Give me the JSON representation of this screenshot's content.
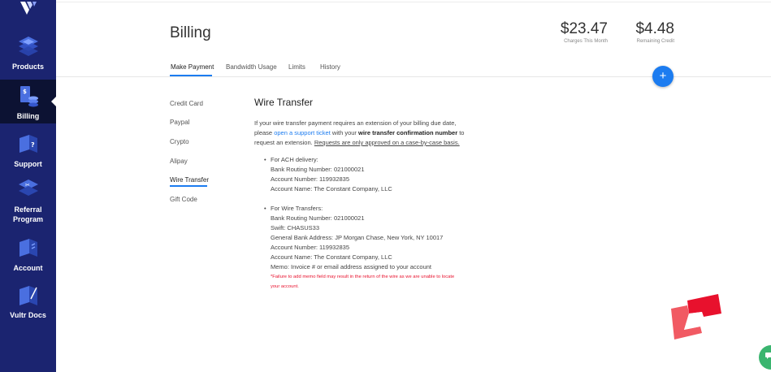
{
  "sidebar": {
    "items": [
      {
        "label": "Products",
        "icon": "products-icon"
      },
      {
        "label": "Billing",
        "icon": "billing-icon",
        "active": true
      },
      {
        "label": "Support",
        "icon": "support-icon"
      },
      {
        "label": "Referral Program",
        "label_line1": "Referral",
        "label_line2": "Program",
        "icon": "referral-icon"
      },
      {
        "label": "Account",
        "icon": "account-icon"
      },
      {
        "label": "Vultr Docs",
        "icon": "docs-icon"
      }
    ]
  },
  "header": {
    "title": "Billing",
    "charges": {
      "value": "$23.47",
      "label": "Charges This Month"
    },
    "credit": {
      "value": "$4.48",
      "label": "Remaining Credit"
    }
  },
  "tabs": [
    "Make Payment",
    "Bandwidth Usage",
    "Limits",
    "History"
  ],
  "fab_label": "+",
  "submenu": [
    "Credit Card",
    "Paypal",
    "Crypto",
    "Alipay",
    "Wire Transfer",
    "Gift Code"
  ],
  "content": {
    "title": "Wire Transfer",
    "intro_1": "If your wire transfer payment requires an extension of your billing due date,",
    "intro_2_a": "please ",
    "intro_2_link": "open a support ticket",
    "intro_2_b": " with your ",
    "intro_2_bold": "wire transfer confirmation number",
    "intro_2_c": " to",
    "intro_3_a": "request an extension. ",
    "intro_3_u": "Requests are only approved on a case-by-case basis.",
    "ach": {
      "heading": "For ACH delivery:",
      "routing": "Bank Routing Number: 021000021",
      "account": "Account Number: 119932835",
      "name": "Account Name: The Constant Company, LLC"
    },
    "wire": {
      "heading": "For Wire Transfers:",
      "routing": "Bank Routing Number: 021000021",
      "swift": "Swift: CHASUS33",
      "address": "General Bank Address: JP Morgan Chase, New York, NY 10017",
      "account": "Account Number: 119932835",
      "name": "Account Name: The Constant Company, LLC",
      "memo": "Memo: Invoice # or email address assigned to your account",
      "warning_1": "*Failure to add memo field may result in the return of the wire as we are unable to locate",
      "warning_2": "your account."
    }
  },
  "colors": {
    "sidebar": "#1b2470",
    "sidebar_active": "#0c1233",
    "accent": "#1c7cf0",
    "warning": "#e8112d",
    "chat": "#3ab56f"
  }
}
